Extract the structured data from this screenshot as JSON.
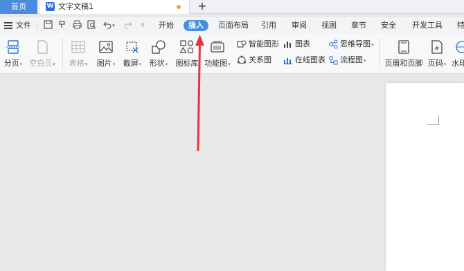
{
  "tabs": {
    "home_label": "首页",
    "doc_title": "文字文稿1",
    "doc_icon_letter": "W",
    "add_label": "+"
  },
  "menu": {
    "file_label": "文件",
    "tabs": [
      {
        "label": "开始"
      },
      {
        "label": "插入",
        "active": true
      },
      {
        "label": "页面布局"
      },
      {
        "label": "引用"
      },
      {
        "label": "审阅"
      },
      {
        "label": "视图"
      },
      {
        "label": "章节"
      },
      {
        "label": "安全"
      },
      {
        "label": "开发工具"
      },
      {
        "label": "特"
      }
    ]
  },
  "ribbon": {
    "page_break": "分页",
    "blank_page": "空白页",
    "table": "表格",
    "picture": "图片",
    "screenshot": "截屏",
    "shape": "形状",
    "icon_lib": "图标库",
    "func_chart": "功能图",
    "smart_shape": "智能图形",
    "chart": "图表",
    "mind_map": "思维导图",
    "relation": "关系图",
    "online_chart": "在线图表",
    "flowchart": "流程图",
    "header_footer": "页眉和页脚",
    "page_number": "页码",
    "watermark": "水印"
  },
  "colors": {
    "accent": "#4a8ddc",
    "arrow": "#e8333a",
    "modified_dot": "#f0a030"
  }
}
